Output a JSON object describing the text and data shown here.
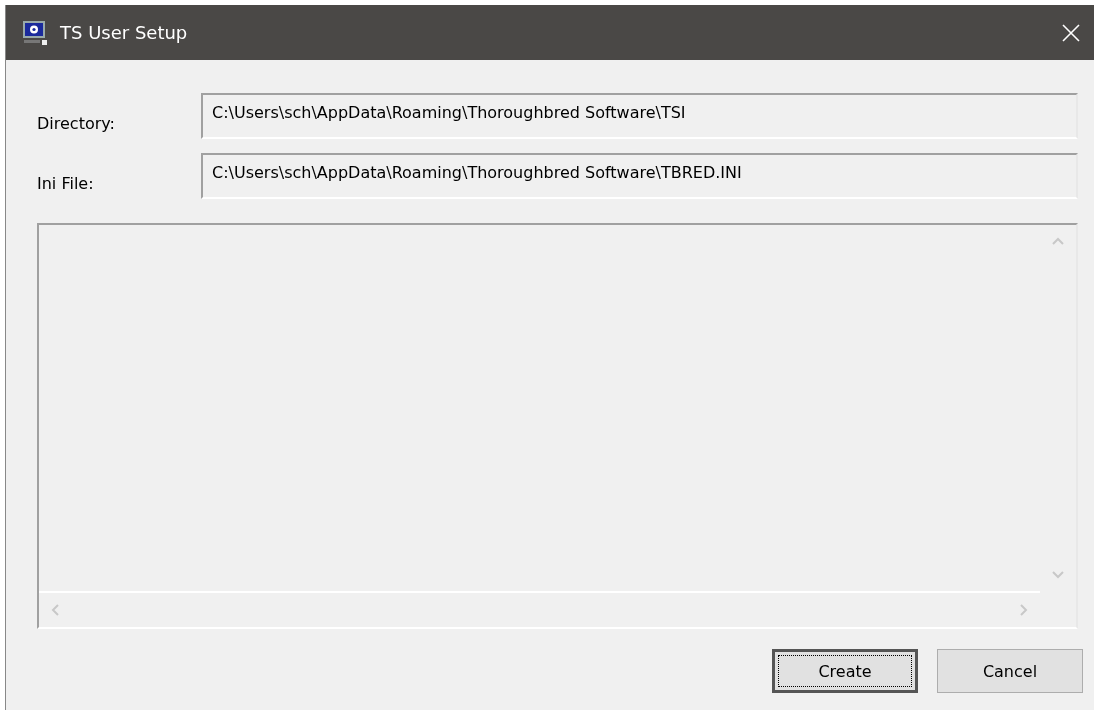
{
  "window": {
    "title": "TS User Setup"
  },
  "fields": [
    {
      "label": "Directory:",
      "value": "C:\\Users\\sch\\AppData\\Roaming\\Thoroughbred Software\\TSI"
    },
    {
      "label": "Ini File:",
      "value": "C:\\Users\\sch\\AppData\\Roaming\\Thoroughbred Software\\TBRED.INI"
    }
  ],
  "buttons": [
    {
      "label": "Create",
      "focused": true
    },
    {
      "label": "Cancel",
      "focused": false
    }
  ]
}
